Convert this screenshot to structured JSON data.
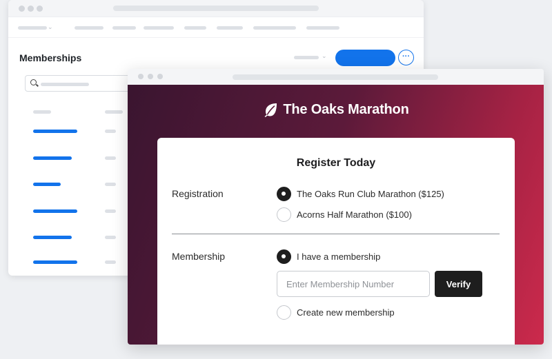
{
  "admin": {
    "title": "Memberships",
    "more_label": "···"
  },
  "registration_page": {
    "brand_name": "The Oaks Marathon",
    "brand_icon": "leaf-icon",
    "form_title": "Register Today",
    "registration": {
      "label": "Registration",
      "options": [
        {
          "label": "The Oaks Run Club Marathon ($125)",
          "selected": true
        },
        {
          "label": "Acorns Half Marathon ($100)",
          "selected": false
        }
      ]
    },
    "membership": {
      "label": "Membership",
      "have_membership_label": "I have a membership",
      "have_membership_selected": true,
      "number_placeholder": "Enter Membership Number",
      "number_value": "",
      "verify_label": "Verify",
      "create_label": "Create new membership",
      "create_selected": false
    }
  },
  "colors": {
    "accent_blue": "#1273eb",
    "gradient_start": "#3a1530",
    "gradient_end": "#cc2a4c",
    "button_dark": "#1e1e1e"
  }
}
